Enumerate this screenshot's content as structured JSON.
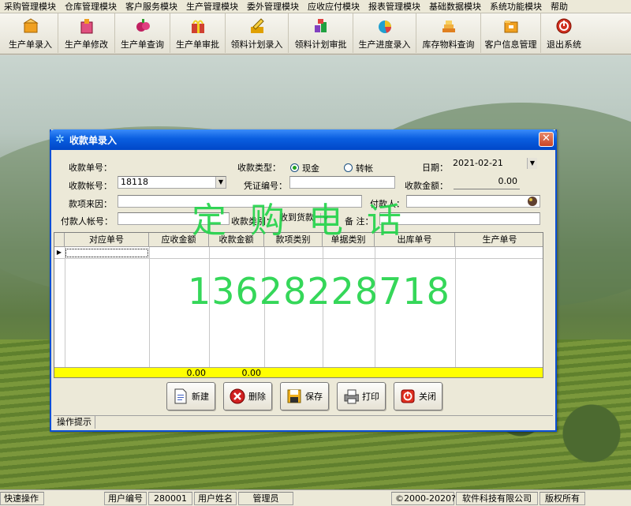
{
  "menu": [
    "采购管理模块",
    "仓库管理模块",
    "客户服务模块",
    "生产管理模块",
    "委外管理模块",
    "应收应付模块",
    "报表管理模块",
    "基础数据模块",
    "系统功能模块",
    "帮助"
  ],
  "toolbar": [
    {
      "label": "生产单录入",
      "icon": "box-icon",
      "color": "#f0a020"
    },
    {
      "label": "生产单修改",
      "icon": "box-edit-icon",
      "color": "#e05080"
    },
    {
      "label": "生产单查询",
      "icon": "search-fruit-icon",
      "color": "#c02060"
    },
    {
      "label": "生产单审批",
      "icon": "gift-icon",
      "color": "#d04030"
    },
    {
      "label": "领料计划录入",
      "icon": "pencil-icon",
      "color": "#e0a000"
    },
    {
      "label": "领料计划审批",
      "icon": "blocks-icon",
      "color": "#8040c0"
    },
    {
      "label": "生产进度录入",
      "icon": "chart-icon",
      "color": "#20a0d0"
    },
    {
      "label": "库存物料查询",
      "icon": "stack-icon",
      "color": "#e08020"
    },
    {
      "label": "客户信息管理",
      "icon": "folder-icon",
      "color": "#f0a020"
    },
    {
      "label": "退出系统",
      "icon": "power-icon",
      "color": "#d03020"
    }
  ],
  "dialog": {
    "title": "收款单录入",
    "fields": {
      "receipt_no_label": "收款单号：",
      "receipt_type_label": "收款类型：",
      "cash_label": "现金",
      "transfer_label": "转帐",
      "date_label": "日期：",
      "date_value": "2021-02-21",
      "account_label": "收款帐号：",
      "account_value": "18118",
      "voucher_label": "凭证编号：",
      "amount_label": "收款金额：",
      "amount_value": "0.00",
      "source_label": "款项来因：",
      "payer_label": "付款人：",
      "payer_account_label": "付款人帐号：",
      "category_label": "收款类别：",
      "category_value": "收到货款",
      "remark_label": "备 注："
    },
    "grid": {
      "columns": [
        "对应单号",
        "应收金额",
        "收款金额",
        "款项类别",
        "单据类别",
        "出库单号",
        "生产单号"
      ],
      "totals": {
        "receivable": "0.00",
        "received": "0.00"
      }
    },
    "buttons": {
      "new": "新建",
      "delete": "删除",
      "save": "保存",
      "print": "打印",
      "close": "关闭"
    },
    "hint": "操作提示"
  },
  "watermark": {
    "line1": "定购电话",
    "line2": "13628228718"
  },
  "status": {
    "quick": "快速操作",
    "user_no_label": "用户编号",
    "user_no": "280001",
    "user_name_label": "用户姓名",
    "user_name": "管理员",
    "copyright": "©2000-2020?",
    "company": "软件科技有限公司",
    "rights": "版权所有"
  },
  "colors": {
    "title_blue": "#0a5ee0",
    "total_yellow": "#ffff00",
    "watermark_green": "#24d44c"
  }
}
